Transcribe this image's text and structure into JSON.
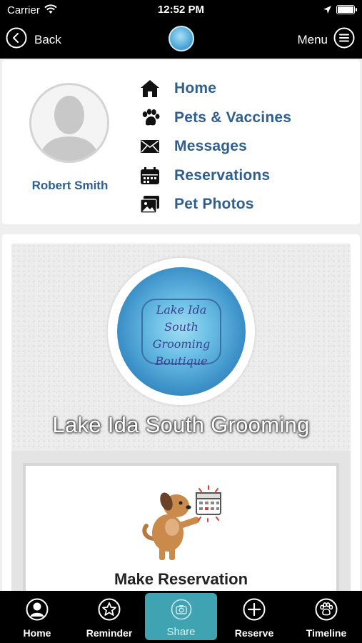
{
  "status_bar": {
    "carrier": "Carrier",
    "time": "12:52 PM"
  },
  "nav": {
    "back_label": "Back",
    "menu_label": "Menu"
  },
  "profile": {
    "name": "Robert Smith",
    "menu": [
      {
        "label": "Home",
        "icon": "house-icon"
      },
      {
        "label": "Pets & Vaccines",
        "icon": "paw-icon"
      },
      {
        "label": "Messages",
        "icon": "envelope-icon"
      },
      {
        "label": "Reservations",
        "icon": "calendar-icon"
      },
      {
        "label": "Pet Photos",
        "icon": "photos-icon"
      }
    ]
  },
  "business": {
    "name": "Lake Ida South Grooming",
    "logo_lines": [
      "Lake Ida",
      "South",
      "Grooming",
      "Boutique"
    ]
  },
  "actions": {
    "reserve_label": "Make Reservation"
  },
  "tabs": [
    {
      "label": "Home",
      "icon": "person-circle-icon"
    },
    {
      "label": "Reminder",
      "icon": "star-circle-icon"
    },
    {
      "label": "Share",
      "icon": "camera-icon",
      "active": true
    },
    {
      "label": "Reserve",
      "icon": "plus-circle-icon"
    },
    {
      "label": "Timeline",
      "icon": "paw-circle-icon"
    }
  ],
  "colors": {
    "link_blue": "#2f5f8f",
    "tab_active": "#3fa3b2",
    "bar_bg": "#000000"
  }
}
